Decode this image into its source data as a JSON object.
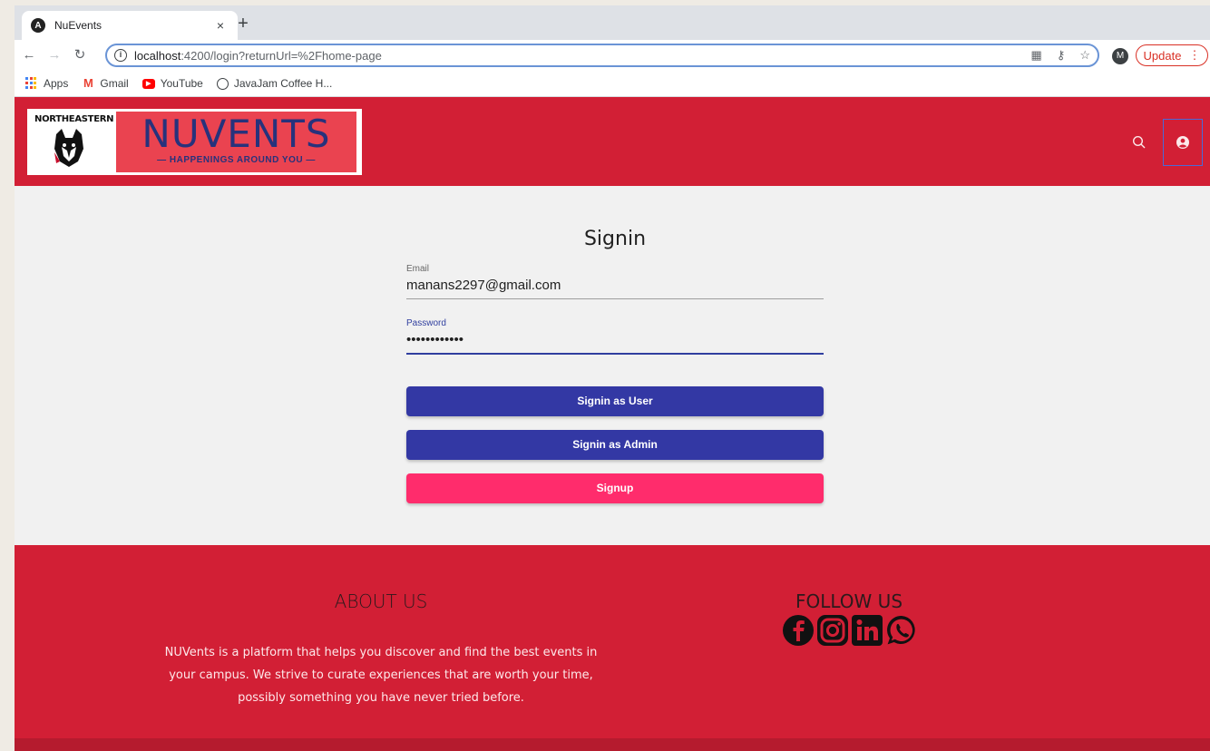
{
  "browser": {
    "tab_title": "NuEvents",
    "tab_close": "×",
    "new_tab": "+",
    "url_host": "localhost",
    "url_path": ":4200/login?returnUrl=%2Fhome-page",
    "profile_initial": "M",
    "update_label": "Update",
    "bookmarks": [
      {
        "label": "Apps",
        "icon": "apps-grid-icon"
      },
      {
        "label": "Gmail",
        "icon": "gmail-icon"
      },
      {
        "label": "YouTube",
        "icon": "youtube-icon"
      },
      {
        "label": "JavaJam Coffee H...",
        "icon": "globe-icon"
      }
    ]
  },
  "header": {
    "logo_left_text": "NORTHEASTERN",
    "logo_title": "NUVENTS",
    "logo_tagline": "— HAPPENINGS AROUND YOU —"
  },
  "signin": {
    "title": "Signin",
    "email_label": "Email",
    "email_value": "manans2297@gmail.com",
    "password_label": "Password",
    "password_value": "••••••••••••",
    "btn_user": "Signin as User",
    "btn_admin": "Signin as Admin",
    "btn_signup": "Signup"
  },
  "footer": {
    "about_title": "ABOUT US",
    "about_text": "NUVents is a platform that helps you discover and find the best events in your campus. We strive to curate experiences that are worth your time, possibly something you have never tried before.",
    "follow_title": "FOLLOW US",
    "social": [
      "facebook-icon",
      "instagram-icon",
      "linkedin-icon",
      "whatsapp-icon"
    ]
  },
  "colors": {
    "brand_red": "#d21f35",
    "button_blue": "#3338a4",
    "button_pink": "#ff2c6c"
  }
}
